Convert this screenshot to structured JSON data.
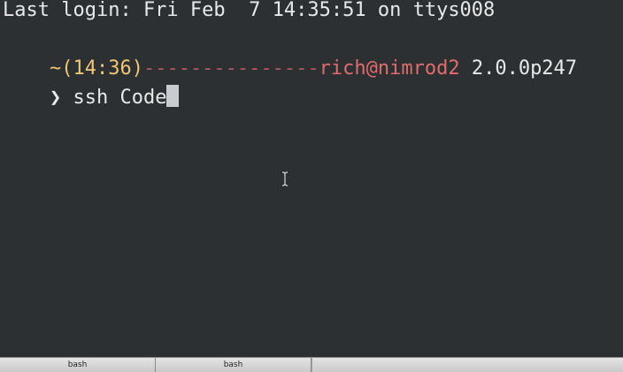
{
  "terminal": {
    "login_line": "Last login: Fri Feb  7 14:35:51 on ttys008",
    "prompt": {
      "tilde": "~",
      "time": "(14:36)",
      "dashes": "---------------",
      "user_host": "rich@nimrod2",
      "ruby_version": " 2.0.0p247"
    },
    "input": {
      "prompt_symbol": "❯",
      "command": " ssh Code"
    }
  },
  "tabs": [
    {
      "label": "bash"
    },
    {
      "label": "bash"
    }
  ],
  "colors": {
    "background": "#2d3033",
    "text": "#e8e8e8",
    "time_yellow": "#f0c674",
    "dashes_pink": "#cc6666",
    "user_host_red": "#e06c6c",
    "cursor": "#c8ccd0"
  }
}
